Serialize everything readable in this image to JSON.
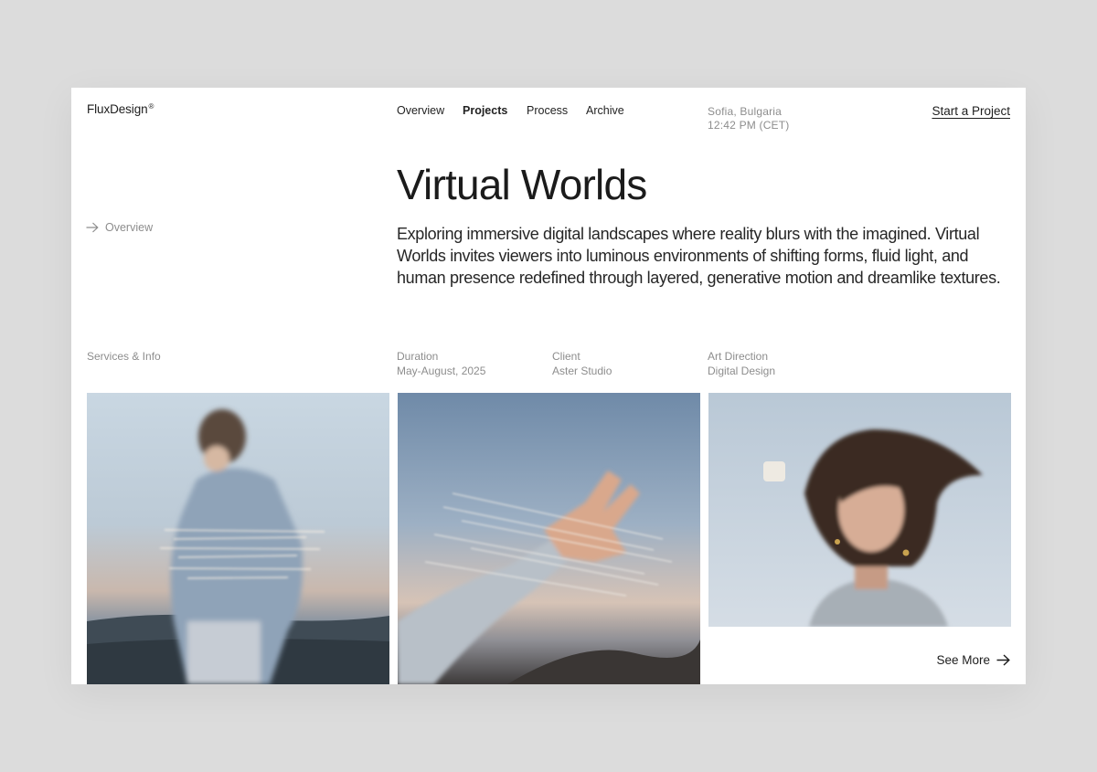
{
  "header": {
    "brand": "FluxDesign",
    "brand_mark": "®",
    "nav": [
      {
        "label": "Overview",
        "active": false
      },
      {
        "label": "Projects",
        "active": true
      },
      {
        "label": "Process",
        "active": false
      },
      {
        "label": "Archive",
        "active": false
      }
    ],
    "location": {
      "city": "Sofia, Bulgaria",
      "time": "12:42 PM (CET)"
    },
    "cta_label": "Start a Project"
  },
  "sidebar": {
    "back_label": "Overview",
    "back_icon": "arrow-right-icon"
  },
  "project": {
    "title": "Virtual Worlds",
    "description": "Exploring immersive digital landscapes where reality blurs with the imagined. Virtual Worlds invites viewers into luminous environments of shifting forms, fluid light, and human presence redefined through layered, generative motion and dreamlike textures."
  },
  "info": {
    "section_label": "Services & Info",
    "duration": {
      "label": "Duration",
      "value": "May-August, 2025"
    },
    "client": {
      "label": "Client",
      "value": "Aster Studio"
    },
    "services": {
      "label": "Art Direction",
      "value": "Digital Design"
    }
  },
  "gallery": {
    "images": [
      {
        "subject": "blurred figure in denim jacket facing horizon"
      },
      {
        "subject": "motion-blurred raised hand against sky"
      },
      {
        "subject": "portrait of woman with windswept dark hair"
      }
    ],
    "see_more_label": "See More",
    "see_more_icon": "arrow-right-icon"
  },
  "colors": {
    "background": "#dcdcdc",
    "card": "#ffffff",
    "text": "#1b1b1b",
    "muted": "#8d8d8d"
  }
}
